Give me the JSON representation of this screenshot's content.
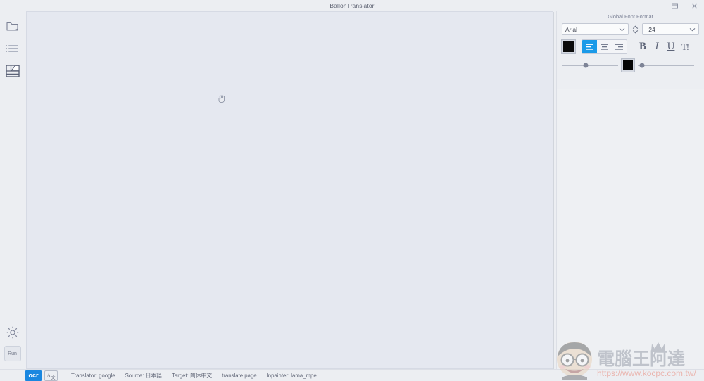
{
  "window": {
    "title": "BallonTranslator",
    "controls": [
      {
        "name": "minimize",
        "glyph": "minimize-icon"
      },
      {
        "name": "maximize",
        "glyph": "maximize-icon"
      },
      {
        "name": "close",
        "glyph": "close-icon"
      }
    ]
  },
  "sidebar": {
    "items": [
      {
        "name": "open-folder",
        "icon": "open-folder-icon",
        "active": false
      },
      {
        "name": "page-list",
        "icon": "list-icon",
        "active": false
      },
      {
        "name": "panel-layout",
        "icon": "layout-panel-icon",
        "active": true
      }
    ],
    "settings": {
      "name": "settings",
      "icon": "gear-icon"
    },
    "run_label": "Run"
  },
  "canvas": {
    "cursor": "grab-hand-cursor"
  },
  "right_panel": {
    "title": "Global Font Format",
    "font_family": {
      "value": "Arial",
      "placeholder": "Arial"
    },
    "font_size": {
      "value": "24",
      "placeholder": "24"
    },
    "text_color": "#0b0b0b",
    "stroke_color": "#050505",
    "alignment": {
      "options": [
        "align-left",
        "align-center",
        "align-right"
      ],
      "selected": "align-left",
      "accent": "#1a9ae8"
    },
    "styles": [
      {
        "name": "bold",
        "label": "B"
      },
      {
        "name": "italic",
        "label": "I"
      },
      {
        "name": "underline",
        "label": "U"
      },
      {
        "name": "stroke-text",
        "label": "T!"
      }
    ],
    "sliders": [
      {
        "name": "left-slider",
        "value": 42
      },
      {
        "name": "right-slider",
        "value": 8
      }
    ]
  },
  "status_bar": {
    "ocr_label": "ocr",
    "translate_icon": "translate-icon",
    "items": [
      {
        "name": "translator",
        "label": "Translator: google"
      },
      {
        "name": "source-language",
        "label": "Source: 日本語"
      },
      {
        "name": "target-language",
        "label": "Target: 简体中文"
      },
      {
        "name": "translate-page",
        "label": "translate page"
      },
      {
        "name": "inpainter",
        "label": "Inpainter: lama_mpe"
      }
    ]
  },
  "watermark": {
    "text": "電腦王阿達",
    "url": "https://www.kocpc.com.tw/",
    "color": "#e8604a"
  }
}
